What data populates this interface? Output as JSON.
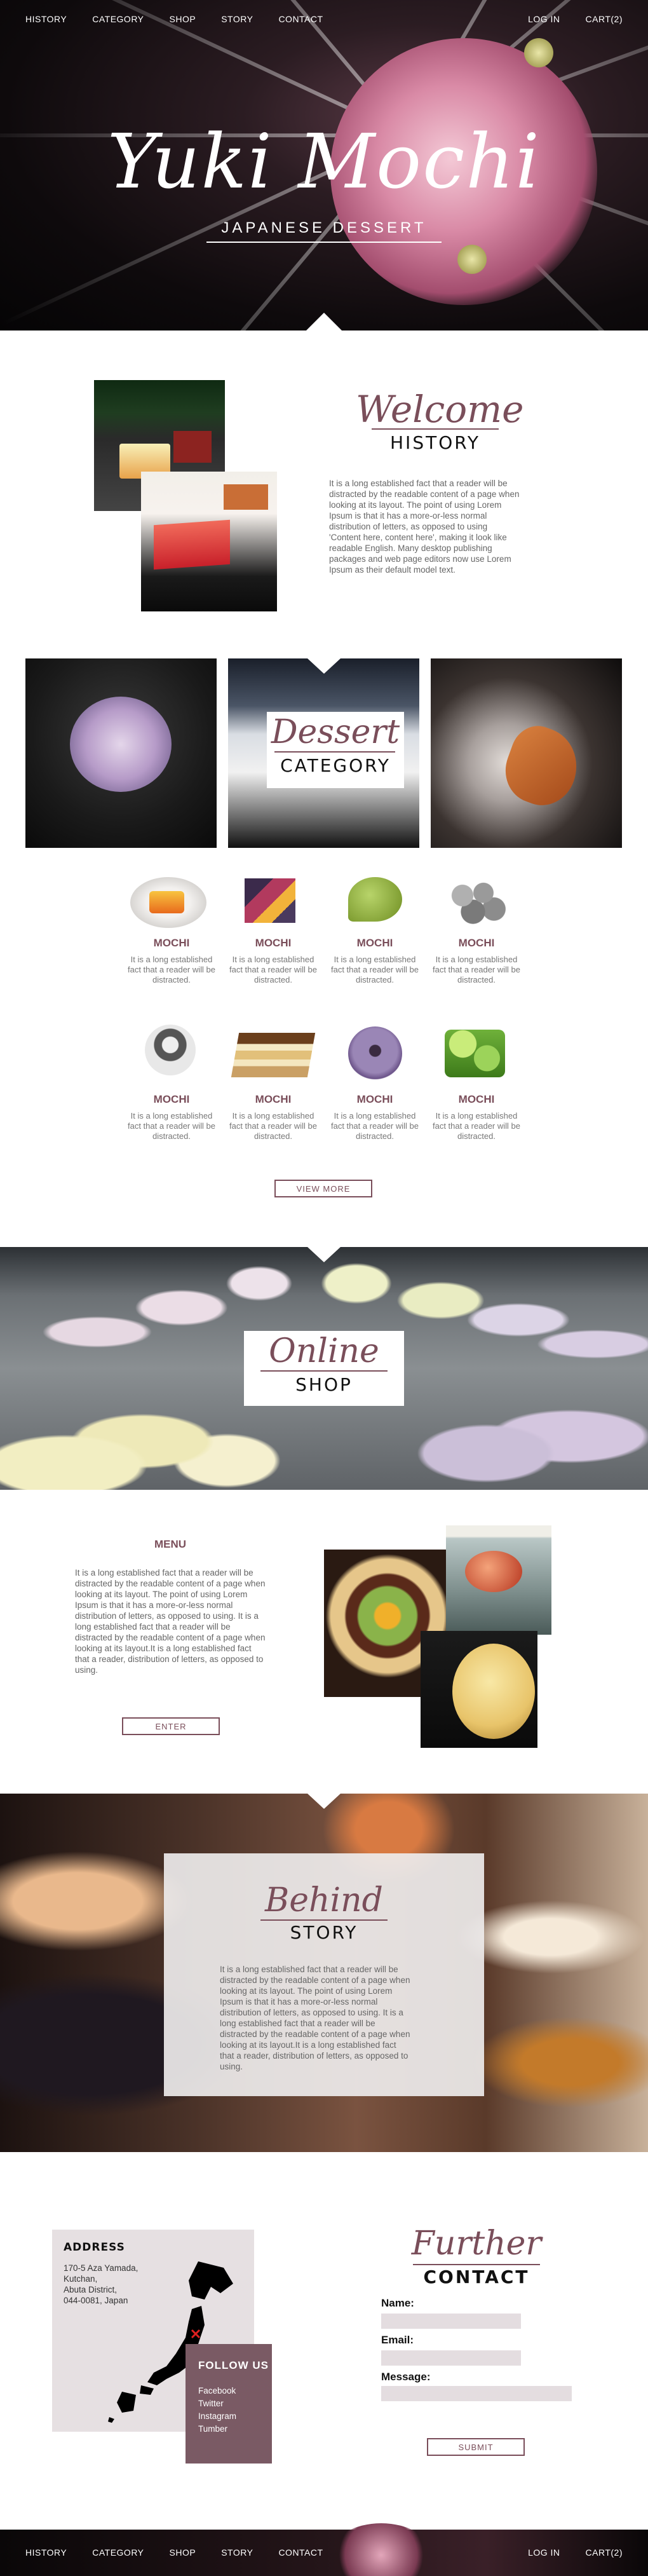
{
  "nav": {
    "left": [
      "HISTORY",
      "CATEGORY",
      "SHOP",
      "STORY",
      "CONTACT"
    ],
    "right": [
      "LOG IN",
      "CART(2)"
    ]
  },
  "hero": {
    "title": "Yuki Mochi",
    "subtitle": "JAPANESE DESSERT"
  },
  "history": {
    "script": "Welcome",
    "heading": "HISTORY",
    "text": "It is a long established fact that a reader will be distracted by the readable content of a page when looking at its layout. The point of using Lorem Ipsum is that it has a more-or-less normal distribution of letters, as opposed to using 'Content here, content here', making it look like readable English. Many desktop publishing packages and web page editors now use Lorem Ipsum as their default model text."
  },
  "category": {
    "script": "Dessert",
    "heading": "CATEGORY",
    "products": [
      {
        "title": "MOCHI",
        "desc": "It is a long established fact that a reader will be distracted."
      },
      {
        "title": "MOCHI",
        "desc": "It is a long established fact that a reader will be distracted."
      },
      {
        "title": "MOCHI",
        "desc": "It is a long established fact that a reader will be distracted."
      },
      {
        "title": "MOCHI",
        "desc": "It is a long established fact that a reader will be distracted."
      },
      {
        "title": "MOCHI",
        "desc": "It is a long established fact that a reader will be distracted."
      },
      {
        "title": "MOCHI",
        "desc": "It is a long established fact that a reader will be distracted."
      },
      {
        "title": "MOCHI",
        "desc": "It is a long established fact that a reader will be distracted."
      },
      {
        "title": "MOCHI",
        "desc": "It is a long established fact that a reader will be distracted."
      }
    ],
    "view_more": "VIEW MORE"
  },
  "shop": {
    "script": "Online",
    "heading": "SHOP"
  },
  "menu": {
    "heading": "MENU",
    "text": "It is a long established fact that a reader will be distracted by the readable content of a page when looking at its layout. The point of using Lorem Ipsum is that it has a more-or-less normal distribution of letters, as opposed to using. It is a long established fact that a reader will be distracted by the readable content of a page when looking at its layout.It is a long established fact that a reader, distribution of letters, as opposed to using.",
    "button": "ENTER"
  },
  "story": {
    "script": "Behind",
    "heading": "STORY",
    "text": "It is a long established fact that a reader will be distracted by the readable content of a page when looking at its layout. The point of using Lorem Ipsum is that it has a more-or-less normal distribution of letters, as opposed to using. It is a long established fact that a reader will be distracted by the readable content of a page when looking at its layout.It is a long established fact that a reader, distribution of letters, as opposed to using."
  },
  "contact": {
    "address_heading": "ADDRESS",
    "address_lines": [
      "170-5 Aza Yamada,",
      "Kutchan,",
      "Abuta District,",
      "044-0081, Japan"
    ],
    "follow_heading": "FOLLOW US",
    "follow_links": [
      "Facebook",
      "Twitter",
      "Instagram",
      "Tumber"
    ],
    "script": "Further",
    "heading": "CONTACT",
    "name_label": "Name:",
    "email_label": "Email:",
    "message_label": "Message:",
    "submit": "SUBMIT"
  },
  "footer_nav": {
    "left": [
      "HISTORY",
      "CATEGORY",
      "SHOP",
      "STORY",
      "CONTACT"
    ],
    "right": [
      "LOG IN",
      "CART(2)"
    ]
  },
  "colors": {
    "accent": "#7a4e5a",
    "field": "#e4dde0",
    "panel": "#e6e0e2"
  }
}
